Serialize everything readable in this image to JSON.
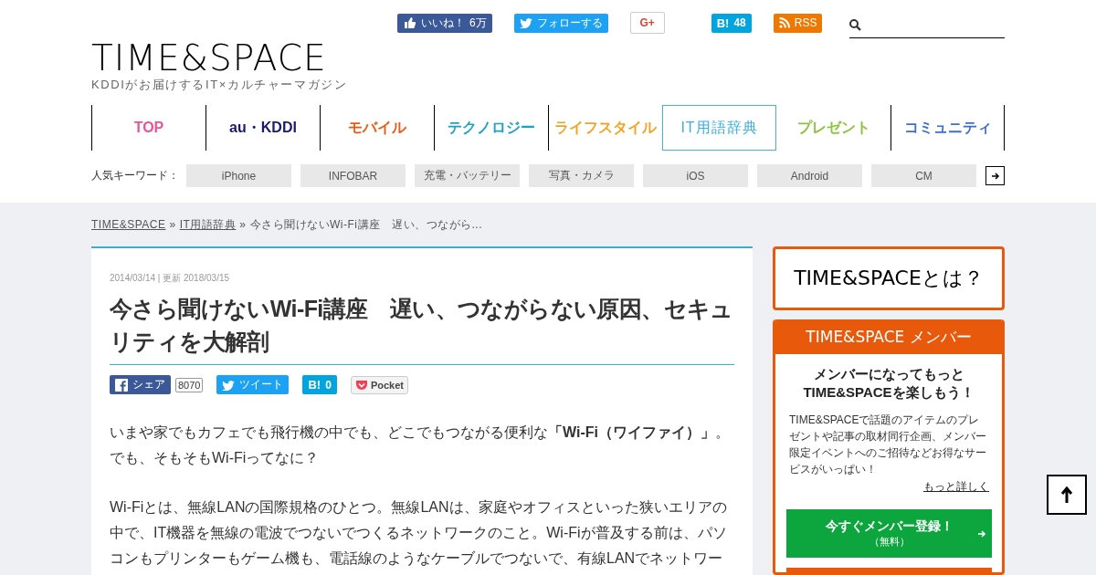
{
  "social_bar": [
    {
      "kind": "facebook",
      "label": "いいね！",
      "count": "6万"
    },
    {
      "kind": "twitter",
      "label": "フォローする"
    },
    {
      "kind": "googleplus",
      "label": "G+"
    },
    {
      "kind": "hatena",
      "label": "B!",
      "count": "48"
    },
    {
      "kind": "rss",
      "label": "RSS"
    }
  ],
  "logo": {
    "wordmark": "TIME&SPACE",
    "tagline": "KDDIがお届けするIT×カルチャーマガジン"
  },
  "nav": [
    {
      "label": "TOP",
      "color": "#e8559b",
      "selected": false
    },
    {
      "label": "au・KDDI",
      "color": "#1a1a6e",
      "selected": false
    },
    {
      "label": "モバイル",
      "color": "#ea5a12",
      "selected": false
    },
    {
      "label": "テクノロジー",
      "color": "#1aa3c2",
      "selected": false
    },
    {
      "label": "ライフスタイル",
      "color": "#f5a21e",
      "selected": false
    },
    {
      "label": "IT用語辞典",
      "color": "#3ab0e0",
      "selected": true
    },
    {
      "label": "プレゼント",
      "color": "#8cc43c",
      "selected": false
    },
    {
      "label": "コミュニティ",
      "color": "#3b6fd8",
      "selected": false
    }
  ],
  "keywords": {
    "label": "人気キーワード：",
    "items": [
      "iPhone",
      "INFOBAR",
      "充電・バッテリー",
      "写真・カメラ",
      "iOS",
      "Android",
      "CM"
    ]
  },
  "breadcrumb": {
    "separator": "»",
    "items": [
      "TIME&SPACE",
      "IT用語辞典",
      "今さら聞けないWi-Fi講座　遅い、つながら..."
    ]
  },
  "article": {
    "dates": "2014/03/14 | 更新 2018/03/15",
    "title": "今さら聞けないWi-Fi講座　遅い、つながらない原因、セキュリティを大解剖",
    "share": [
      {
        "kind": "facebook",
        "label": "シェア",
        "count": "8070"
      },
      {
        "kind": "twitter",
        "label": "ツイート"
      },
      {
        "kind": "hatena",
        "label": "B!",
        "count": "0"
      },
      {
        "kind": "pocket",
        "label": "Pocket"
      }
    ],
    "paragraphs": [
      "いまや家でもカフェでも飛行機の中でも、どこでもつながる便利な**「Wi-Fi（ワイファイ）」**。でも、そもそもWi-Fiってなに？",
      "Wi-Fiとは、無線LANの国際規格のひとつ。無線LANは、家庭やオフィスといった狭いエリアの中で、IT機器を無線の電波でつないでつくるネットワークのこと。Wi-Fiが普及する前は、パソコンもプリンターもゲーム機も、電話線のようなケーブルでつないで、有線LANでネットワー"
    ]
  },
  "sidebar": {
    "about": "TIME&SPACEとは？",
    "member": {
      "header": "TIME&SPACE メンバー",
      "heading_lines": [
        "メンバーになってもっと",
        "TIME&SPACEを楽しもう！"
      ],
      "body": "TIME&SPACEで話題のアイテムのプレゼントや記事の取材同行企画、メンバー限定イベントへのご招待などお得なサービスがいっぱい！",
      "link": "もっと詳しく",
      "cta": {
        "label": "今すぐメンバー登録！",
        "sub": "（無料）"
      }
    }
  }
}
